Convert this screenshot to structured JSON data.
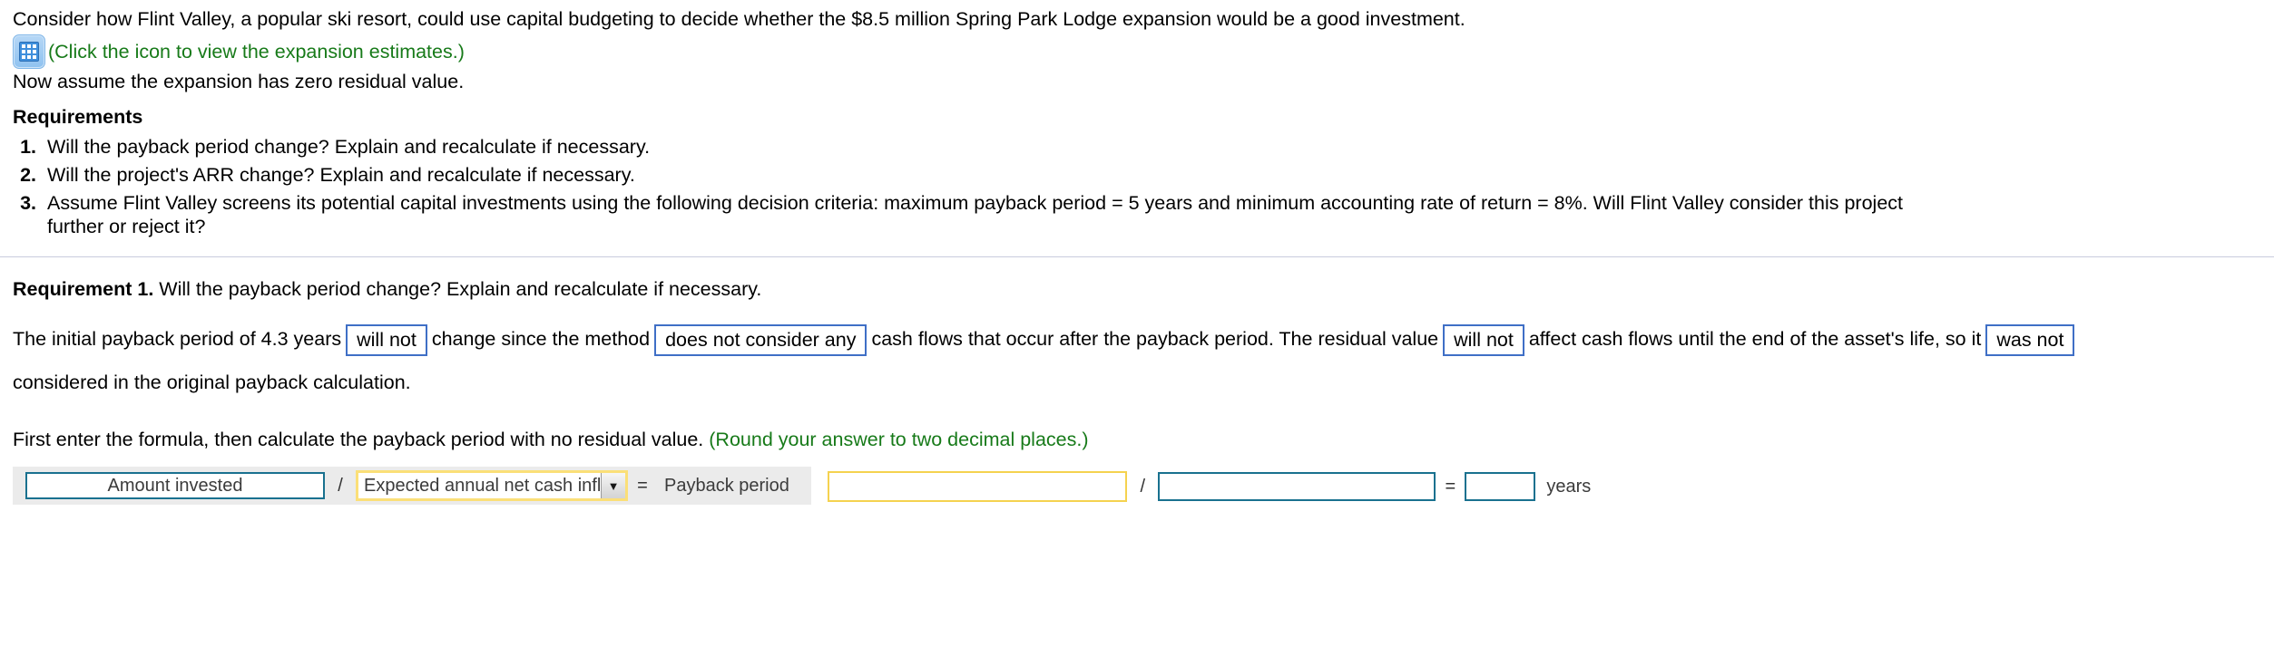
{
  "problem": {
    "statement": "Consider how Flint Valley, a popular ski resort, could use capital budgeting to decide whether the $8.5 million Spring Park Lodge expansion would be a good investment.",
    "icon_name": "table-grid-icon",
    "icon_caption": "(Click the icon to view the expansion estimates.)",
    "assumption": "Now assume the expansion has zero residual value.",
    "requirements_heading": "Requirements",
    "requirements": [
      {
        "num": "1.",
        "text": "Will the payback period change? Explain and recalculate if necessary."
      },
      {
        "num": "2.",
        "text": "Will the project's ARR change? Explain and recalculate if necessary."
      },
      {
        "num": "3.",
        "text": "Assume Flint Valley screens its potential capital investments using the following decision criteria: maximum payback period = 5 years and minimum accounting rate of return = 8%. Will Flint Valley consider this project further or reject it?"
      }
    ]
  },
  "answer": {
    "heading_bold": "Requirement 1.",
    "heading_rest": " Will the payback period change? Explain and recalculate if necessary.",
    "paragraph": {
      "seg1": "The initial payback period of 4.3 years",
      "blank1": "will not",
      "seg2": "change since the method",
      "blank2": "does not consider any",
      "seg3": "cash flows that occur after the payback period. The residual value",
      "blank3": "will not",
      "seg4": "affect cash flows until the end of the",
      "seg5": "asset's life, so it",
      "blank4": "was not",
      "seg6": "considered in the original payback calculation."
    },
    "instruction": "First enter the formula, then calculate the payback period with no residual value.",
    "instruction_green": "(Round your answer to two decimal places.)"
  },
  "formula": {
    "header": {
      "amount_label": "Amount invested",
      "divider_symbol": "/",
      "select_value": "Expected annual net cash inflow",
      "select_arrow": "▼",
      "equals_symbol": "=",
      "result_label": "Payback period"
    },
    "inputs": {
      "amount_value": "",
      "amount_placeholder": "",
      "divider_symbol": "/",
      "inflow_value": "",
      "inflow_placeholder": "",
      "equals_symbol": "=",
      "result_value": "",
      "result_placeholder": "",
      "unit": "years"
    }
  },
  "colors": {
    "green_text": "#177a19",
    "blank_border": "#3f6fc6",
    "teal_border": "#19718f",
    "yellow_border": "#f5d24f",
    "header_band": "#ebebeb",
    "divider": "#c9cbdd"
  }
}
